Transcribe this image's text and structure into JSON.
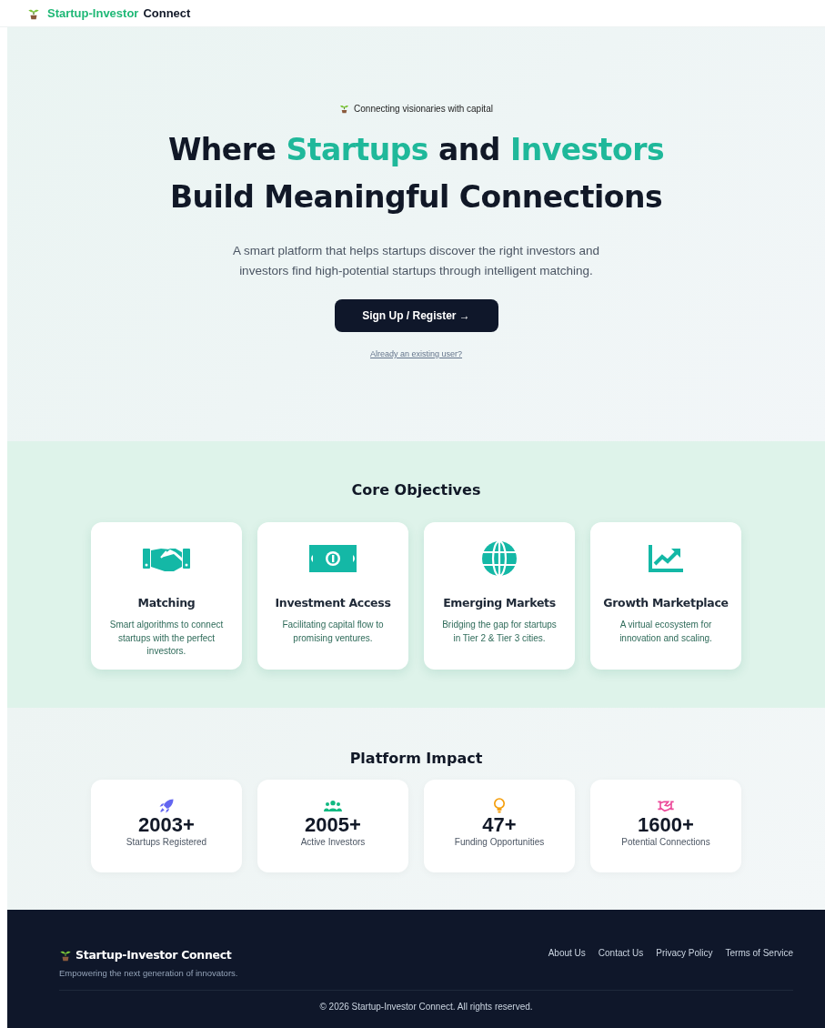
{
  "header": {
    "brand_accent": "Startup-Investor",
    "brand_rest": "Connect"
  },
  "hero": {
    "tagline": "Connecting visionaries with capital",
    "headline": [
      [
        {
          "text": "Where ",
          "accent": false
        },
        {
          "text": "Startups",
          "accent": true
        },
        {
          "text": " and ",
          "accent": false
        },
        {
          "text": "Investors",
          "accent": true
        }
      ],
      [
        {
          "text": "Build Meaningful Connections",
          "accent": false
        }
      ]
    ],
    "description": "A smart platform that helps startups discover the right investors and investors find high-potential startups through intelligent matching.",
    "primary_button": "Sign Up / Register →",
    "login_link": "Already an existing user?"
  },
  "objectives": {
    "title": "Core Objectives",
    "items": [
      {
        "title": "Matching",
        "text": "Smart algorithms to connect startups with the perfect investors."
      },
      {
        "title": "Investment Access",
        "text": "Facilitating capital flow to promising ventures."
      },
      {
        "title": "Emerging Markets",
        "text": "Bridging the gap for startups in Tier 2 & Tier 3 cities."
      },
      {
        "title": "Growth Marketplace",
        "text": "A virtual ecosystem for innovation and scaling."
      }
    ]
  },
  "impact": {
    "title": "Platform Impact",
    "stats": [
      {
        "value": "2003+",
        "label": "Startups Registered",
        "color": "#6366f1"
      },
      {
        "value": "2005+",
        "label": "Active Investors",
        "color": "#10b981"
      },
      {
        "value": "47+",
        "label": "Funding Opportunities",
        "color": "#f59e0b"
      },
      {
        "value": "1600+",
        "label": "Potential Connections",
        "color": "#ec4899"
      }
    ]
  },
  "footer": {
    "brand": "Startup-Investor Connect",
    "tagline": "Empowering the next generation of innovators.",
    "links": [
      "About Us",
      "Contact Us",
      "Privacy Policy",
      "Terms of Service"
    ],
    "copyright": "© 2026 Startup-Investor Connect. All rights reserved."
  }
}
